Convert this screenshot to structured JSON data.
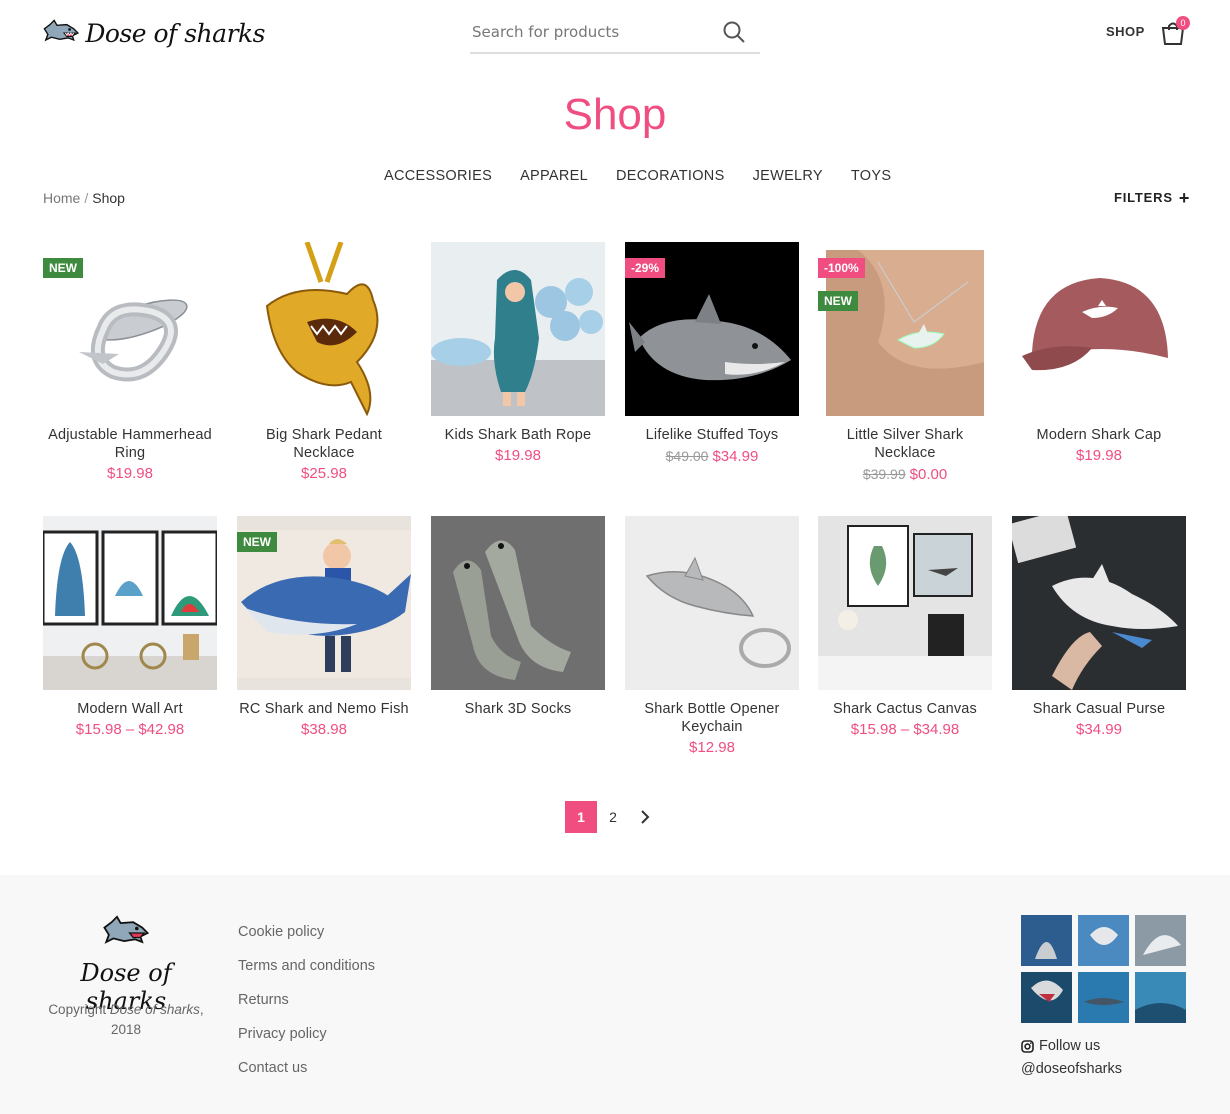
{
  "header": {
    "logo_text": "Dose of sharks",
    "search_placeholder": "Search for products",
    "shop_label": "SHOP",
    "cart_count": "0"
  },
  "page_title": "Shop",
  "categories": [
    "ACCESSORIES",
    "APPAREL",
    "DECORATIONS",
    "JEWELRY",
    "TOYS"
  ],
  "breadcrumb": {
    "home": "Home",
    "sep": "/",
    "current": "Shop"
  },
  "filters_label": "FILTERS",
  "products": [
    {
      "name": "Adjustable Hammerhead Ring",
      "price": "$19.98",
      "badges": [
        "NEW"
      ]
    },
    {
      "name": "Big Shark Pedant Necklace",
      "price": "$25.98",
      "badges": []
    },
    {
      "name": "Kids Shark Bath Rope",
      "price": "$19.98",
      "badges": []
    },
    {
      "name": "Lifelike Stuffed Toys",
      "old_price": "$49.00",
      "price": "$34.99",
      "badges": [
        "-29%"
      ]
    },
    {
      "name": "Little Silver Shark Necklace",
      "old_price": "$39.99",
      "price": "$0.00",
      "badges": [
        "-100%",
        "NEW"
      ]
    },
    {
      "name": "Modern Shark Cap",
      "price": "$19.98",
      "badges": []
    },
    {
      "name": "Modern Wall Art",
      "price": "$15.98 – $42.98",
      "badges": []
    },
    {
      "name": "RC Shark and Nemo Fish",
      "price": "$38.98",
      "badges": [
        "NEW"
      ]
    },
    {
      "name": "Shark 3D Socks",
      "price": "",
      "badges": []
    },
    {
      "name": "Shark Bottle Opener Keychain",
      "price": "$12.98",
      "badges": []
    },
    {
      "name": "Shark Cactus Canvas",
      "price": "$15.98 – $34.98",
      "badges": []
    },
    {
      "name": "Shark Casual Purse",
      "price": "$34.99",
      "badges": []
    }
  ],
  "pagination": {
    "pages": [
      "1",
      "2"
    ],
    "current": "1"
  },
  "footer": {
    "logo_text": "Dose of sharks",
    "copyright_prefix": "Copyright",
    "copyright_brand": "Dose of sharks",
    "copyright_year": ", 2018",
    "links": [
      "Cookie policy",
      "Terms and conditions",
      "Returns",
      "Privacy policy",
      "Contact us"
    ],
    "follow_label": "Follow us",
    "instagram_handle": "@doseofsharks"
  },
  "colors": {
    "accent": "#f04e80",
    "new_badge": "#3e8a3e",
    "footer_bg": "#f8f8f8"
  }
}
